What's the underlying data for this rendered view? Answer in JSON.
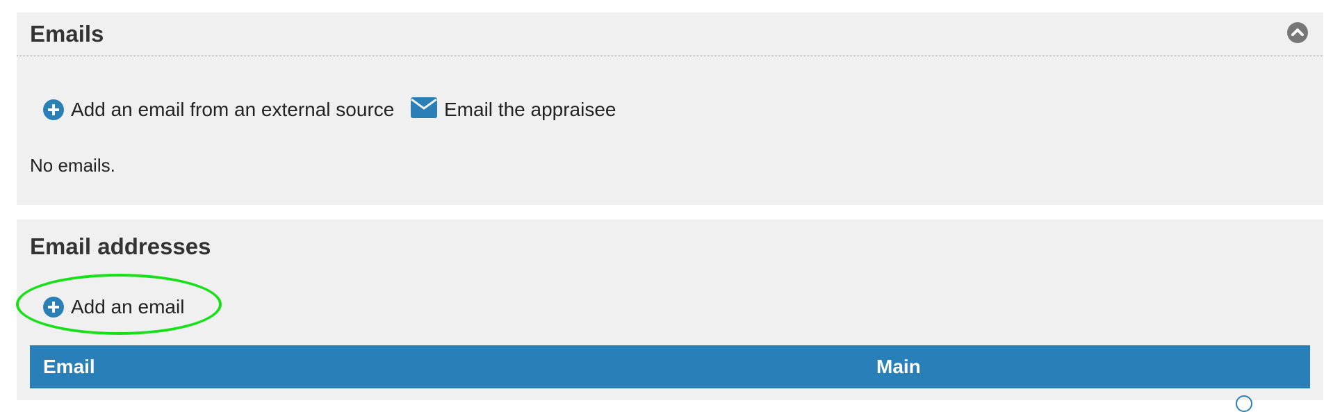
{
  "emails_panel": {
    "title": "Emails",
    "collapse_icon": "chevron-up-icon",
    "actions": {
      "add_external": {
        "icon": "plus-circle-icon",
        "label": "Add an email from an external source"
      },
      "email_appraisee": {
        "icon": "envelope-icon",
        "label": "Email the appraisee"
      }
    },
    "empty_text": "No emails."
  },
  "addresses_panel": {
    "title": "Email addresses",
    "actions": {
      "add_email": {
        "icon": "plus-circle-icon",
        "label": "Add an email"
      }
    },
    "table": {
      "columns": [
        "Email",
        "Main"
      ]
    }
  },
  "colors": {
    "accent": "#2980b9",
    "panel_bg": "#f0f0f0",
    "highlight": "#18e018"
  }
}
